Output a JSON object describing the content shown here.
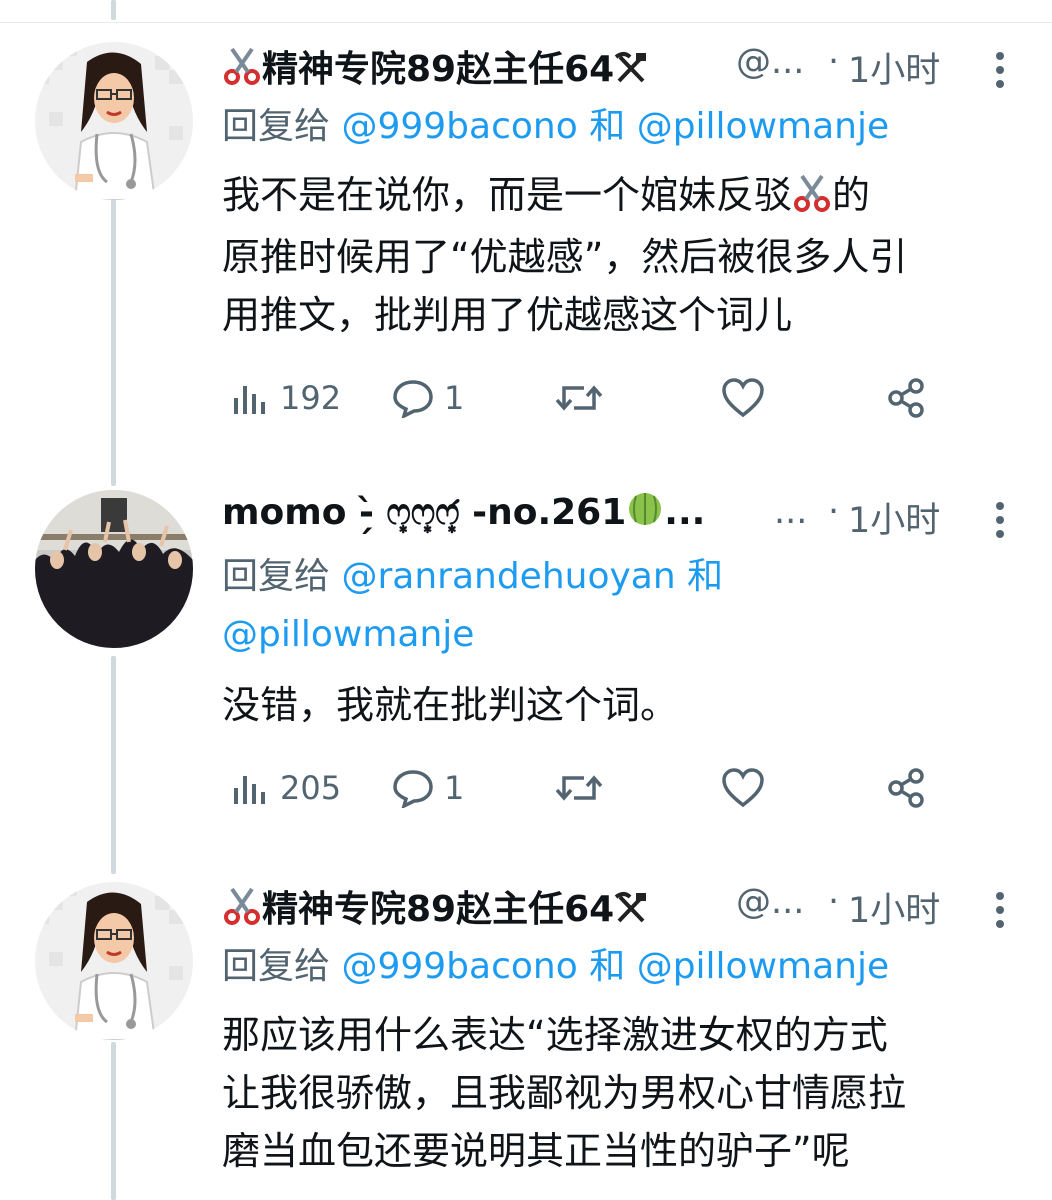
{
  "colors": {
    "text": "#0f1419",
    "secondary": "#536471",
    "link": "#1d9bf0",
    "thread_line": "#cfd9de"
  },
  "tweets": [
    {
      "avatar": "nurse-cartoon-avatar",
      "author": {
        "name_prefix_icon": "scissors-icon",
        "name": "精神专院89赵主任64",
        "name_suffix_icon": "hammer-pick-icon",
        "handle": "@...",
        "separator": "·",
        "time": "1小时"
      },
      "reply_to": {
        "prefix": "回复给",
        "mention1": "@999bacono",
        "and": "和",
        "mention2": "@pillowmanje"
      },
      "text": {
        "line1a": "我不是在说你，而是一个婠妹反驳",
        "line1b": "的",
        "line2": "原推时候用了“优越感”，然后被很多人引",
        "line3": "用推文，批判用了优越感这个词儿"
      },
      "stats": {
        "views": "192",
        "replies": "1"
      }
    },
    {
      "avatar": "group-photo-avatar",
      "author": {
        "name": "momo -̗̀ ෆ͙ෆ͙ෆ͙́ -no.261",
        "name_suffix_icon": "melon-icon",
        "ellipsis": "...",
        "handle": "...",
        "separator": "·",
        "time": "1小时"
      },
      "reply_to": {
        "prefix": "回复给",
        "mention1": "@ranrandehuoyan",
        "and": "和",
        "mention2": "@pillowmanje"
      },
      "text": {
        "line1": "没错，我就在批判这个词。"
      },
      "stats": {
        "views": "205",
        "replies": "1"
      }
    },
    {
      "avatar": "nurse-cartoon-avatar",
      "author": {
        "name_prefix_icon": "scissors-icon",
        "name": "精神专院89赵主任64",
        "name_suffix_icon": "hammer-pick-icon",
        "handle": "@...",
        "separator": "·",
        "time": "1小时"
      },
      "reply_to": {
        "prefix": "回复给",
        "mention1": "@999bacono",
        "and": "和",
        "mention2": "@pillowmanje"
      },
      "text": {
        "line1": "那应该用什么表达“选择激进女权的方式",
        "line2": "让我很骄傲，且我鄙视为男权心甘情愿拉",
        "line3": "磨当血包还要说明其正当性的驴子”呢"
      }
    }
  ]
}
